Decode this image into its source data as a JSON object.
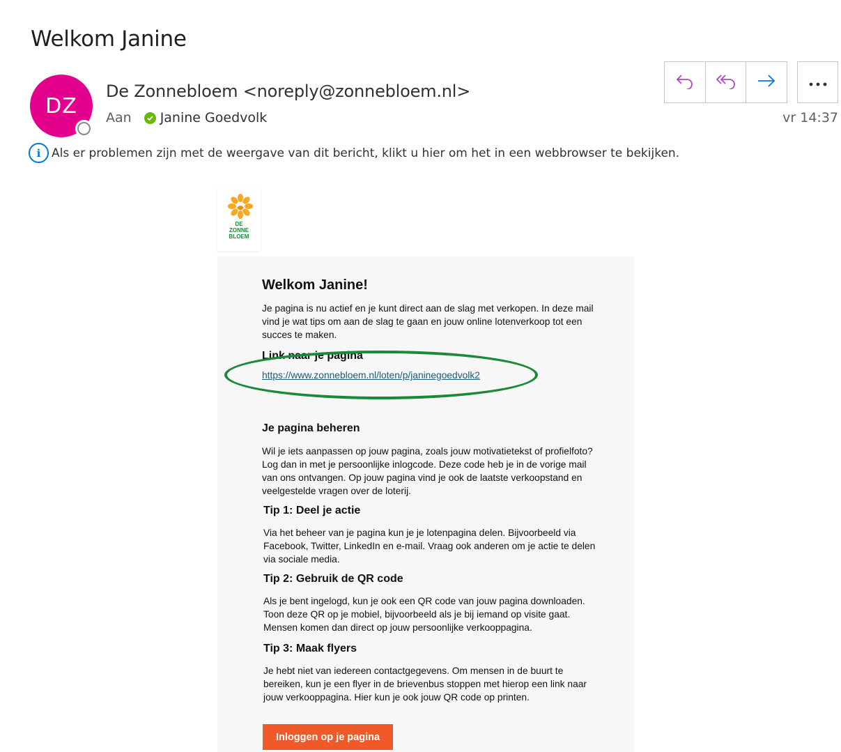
{
  "email": {
    "subject": "Welkom Janine",
    "avatar_initials": "DZ",
    "avatar_color": "#e3008c",
    "sender": "De Zonnebloem <noreply@zonnebloem.nl>",
    "to_label": "Aan",
    "recipient": "Janine Goedvolk",
    "time": "vr 14:37",
    "info_banner": "Als er problemen zijn met de weergave van dit bericht, klikt u hier om het in een webbrowser te bekijken."
  },
  "toolbar": {
    "reply_icon": "reply-icon",
    "reply_all_icon": "reply-all-icon",
    "forward_icon": "forward-icon",
    "more_icon": "more-icon"
  },
  "logo": {
    "line1": "DE",
    "line2": "ZONNE",
    "line3": "BLOEM"
  },
  "body": {
    "title": "Welkom Janine!",
    "intro": "Je pagina is nu actief en je kunt direct aan de slag met verkopen. In deze mail vind je wat tips om aan de slag te gaan en jouw online lotenverkoop tot een succes te maken.",
    "link_heading": "Link naar je pagina",
    "link_url": "https://www.zonnebloem.nl/loten/p/janinegoedvolk2",
    "manage_heading": "Je pagina beheren",
    "manage_text": "Wil je iets aanpassen op jouw pagina, zoals jouw motivatietekst of profielfoto? Log dan in met je persoonlijke inlogcode. Deze code heb je in de vorige mail van ons ontvangen. Op jouw pagina vind je ook de laatste verkoopstand en veelgestelde vragen over de loterij.",
    "tip1_heading": "Tip 1: Deel je actie",
    "tip1_text": "Via het beheer van je pagina kun je je lotenpagina delen. Bijvoorbeeld via Facebook, Twitter, LinkedIn en e-mail. Vraag ook anderen om je actie te delen via sociale media.",
    "tip2_heading": "Tip 2: Gebruik de QR code",
    "tip2_text": "Als je bent ingelogd, kun je ook een QR code van jouw pagina downloaden. Toon deze QR op je mobiel, bijvoorbeeld als je bij iemand op visite gaat. Mensen komen dan direct op jouw persoonlijke verkooppagina.",
    "tip3_heading": "Tip 3: Maak flyers",
    "tip3_text": "Je hebt niet van iedereen contactgegevens. Om mensen in de buurt te bereiken, kun je een flyer in de brievenbus stoppen met hierop een link naar jouw verkooppagina. Hier kun je ook jouw QR code op printen.",
    "cta_label": "Inloggen op je pagina",
    "cta_color": "#f0592a"
  }
}
